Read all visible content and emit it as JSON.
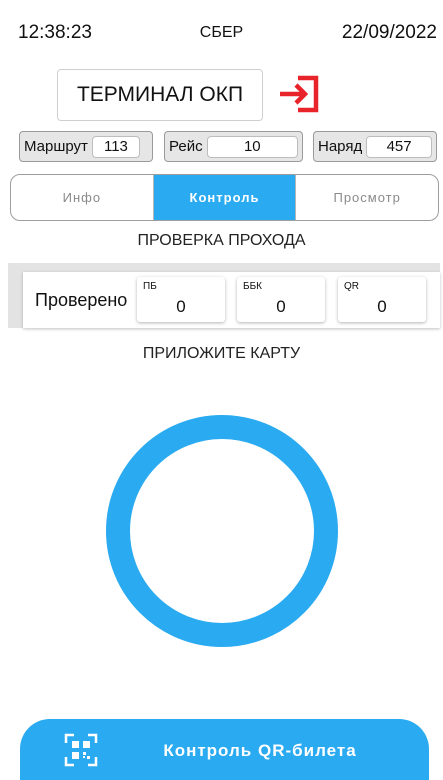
{
  "status_bar": {
    "time": "12:38:23",
    "operator": "СБЕР",
    "date": "22/09/2022"
  },
  "terminal": {
    "title": "ТЕРМИНАЛ ОКП",
    "logout_icon": "logout-icon",
    "logout_color": "#e8232a"
  },
  "trip_info": {
    "route_label": "Маршрут",
    "route_value": "113",
    "trip_label": "Рейс",
    "trip_value": "10",
    "order_label": "Наряд",
    "order_value": "457"
  },
  "tabs": [
    {
      "label": "Инфо",
      "active": false
    },
    {
      "label": "Контроль",
      "active": true
    },
    {
      "label": "Просмотр",
      "active": false
    }
  ],
  "pass_check": {
    "title": "ПРОВЕРКА ПРОХОДА",
    "checked_label": "Проверено",
    "counters": [
      {
        "caption": "ПБ",
        "value": "0"
      },
      {
        "caption": "ББК",
        "value": "0"
      },
      {
        "caption": "QR",
        "value": "0"
      }
    ]
  },
  "card_prompt": "ПРИЛОЖИТЕ КАРТУ",
  "qr_control": {
    "label": "Контроль QR-билета",
    "icon": "qr-code-icon"
  },
  "colors": {
    "accent": "#2aaaf0",
    "danger": "#e8232a"
  }
}
